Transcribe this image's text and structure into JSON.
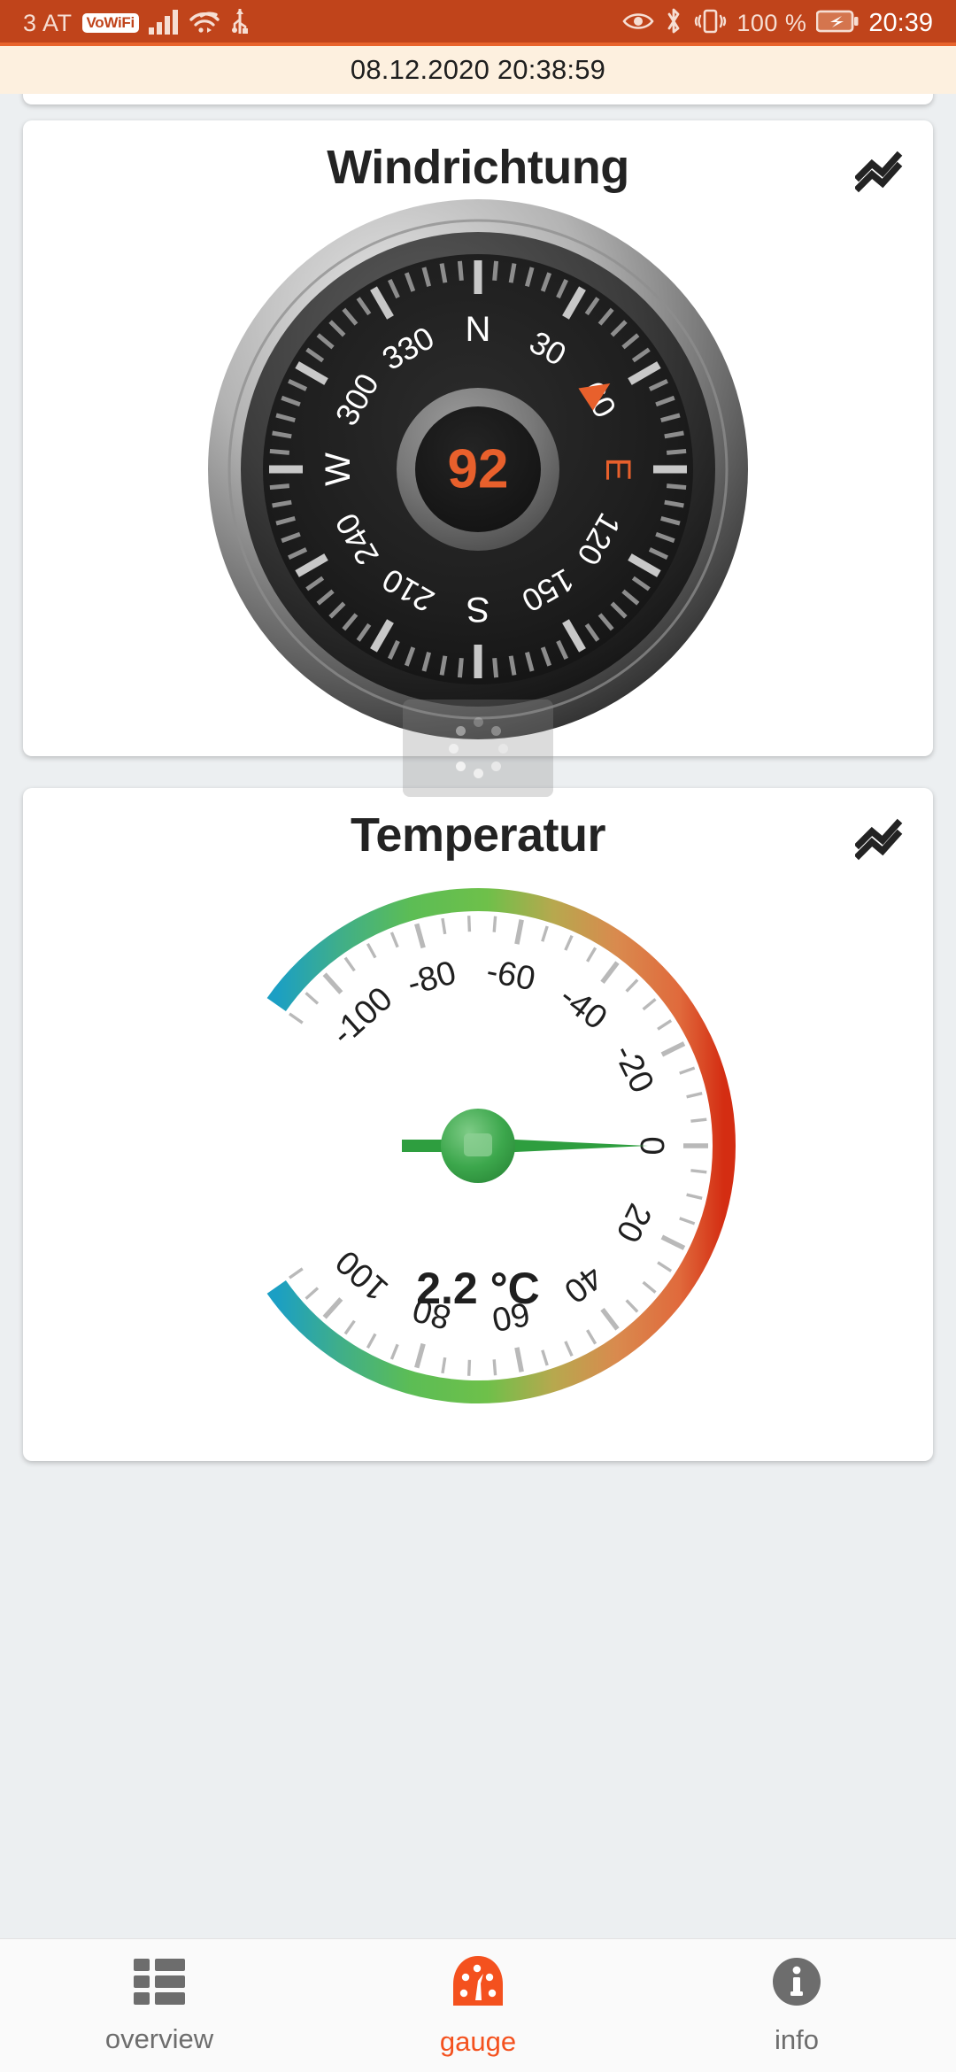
{
  "status_bar": {
    "carrier": "3 AT",
    "vowifi_label": "VoWiFi",
    "battery_percent": "100 %",
    "clock": "20:39",
    "icons": [
      "signal-bars-icon",
      "wifi-icon",
      "usb-icon",
      "eye-icon",
      "bluetooth-icon",
      "vibrate-icon",
      "battery-charging-icon"
    ],
    "background_color": "#c0441b"
  },
  "date_bar": {
    "timestamp": "08.12.2020 20:38:59"
  },
  "cards": [
    {
      "title": "Windrichtung",
      "chart_icon": "chart-zigzag-icon",
      "gauge_kind": "compass"
    },
    {
      "title": "Temperatur",
      "chart_icon": "chart-zigzag-icon",
      "gauge_kind": "thermometer"
    }
  ],
  "chart_data": [
    {
      "type": "gauge",
      "title": "Windrichtung",
      "value": 92,
      "unit": "°",
      "value_label": "92",
      "min": 0,
      "max": 360,
      "needle_angle_deg": 92,
      "tick_labels": [
        "N",
        "30",
        "60",
        "E",
        "120",
        "150",
        "S",
        "210",
        "240",
        "W",
        "300",
        "330"
      ],
      "tick_values": [
        0,
        30,
        60,
        90,
        120,
        150,
        180,
        210,
        240,
        270,
        300,
        330
      ],
      "major_tick_interval": 10,
      "highlight_label": "E",
      "accent_color": "#e8602c",
      "dial_color": "#1c1c1c",
      "bezel_color": "#9a9a9a",
      "label_color": "#ffffff",
      "pointer_color": "#e8602c"
    },
    {
      "type": "gauge",
      "title": "Temperatur",
      "value": 2.2,
      "unit": "°C",
      "value_label": "2.2 °C",
      "min": -110,
      "max": 110,
      "needle_value": 0,
      "tick_labels": [
        "-100",
        "-80",
        "-60",
        "-40",
        "-20",
        "0",
        "20",
        "40",
        "60",
        "80",
        "100"
      ],
      "tick_values": [
        -100,
        -80,
        -60,
        -40,
        -20,
        0,
        20,
        40,
        60,
        80,
        100
      ],
      "minor_tick_interval": 5,
      "arc_start_deg": 215,
      "arc_sweep_deg": 290,
      "gradient_stops": [
        "#1b9fc4",
        "#3fae8a",
        "#5cbd55",
        "#6ec04a",
        "#b7a84e",
        "#d98a4e",
        "#e06a3c",
        "#d42d12"
      ],
      "needle_color": "#2e9e3f",
      "tick_color": "#b9b9b9",
      "label_color": "#1f1f1f"
    }
  ],
  "bottom_nav": {
    "items": [
      {
        "label": "overview",
        "icon": "grid-list-icon",
        "active": false
      },
      {
        "label": "gauge",
        "icon": "speedometer-icon",
        "active": true
      },
      {
        "label": "info",
        "icon": "info-circle-icon",
        "active": false
      }
    ],
    "active_color": "#f4511e",
    "inactive_color": "#6d6d6d"
  }
}
